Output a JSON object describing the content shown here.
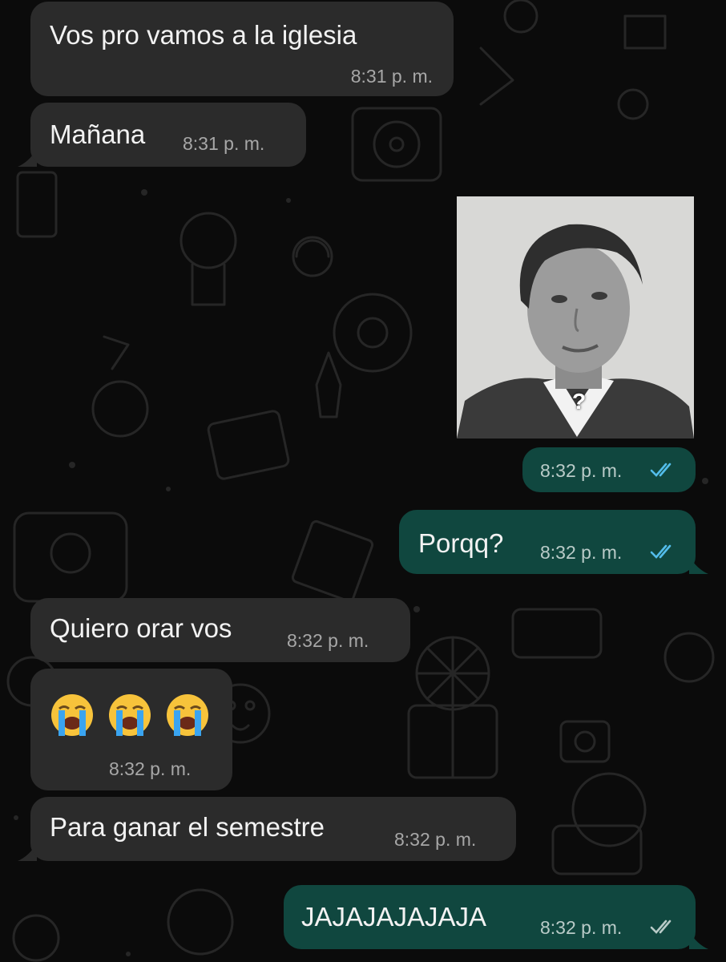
{
  "theme": {
    "incoming_bubble": "#2b2b2b",
    "outgoing_bubble": "#10473f",
    "read_tick_color": "#53bdeb",
    "sent_tick_color": "#b9cbc8"
  },
  "messages": [
    {
      "dir": "in",
      "text": "Vos pro vamos a la iglesia",
      "time": "8:31 p. m."
    },
    {
      "dir": "in",
      "text": "Mañana",
      "time": "8:31 p. m."
    },
    {
      "dir": "out",
      "type": "photo",
      "caption_mark": "?",
      "time": "8:32 p. m.",
      "status": "read"
    },
    {
      "dir": "out",
      "text": "Porqq?",
      "time": "8:32 p. m.",
      "status": "read"
    },
    {
      "dir": "in",
      "text": "Quiero orar vos",
      "time": "8:32 p. m."
    },
    {
      "dir": "in",
      "type": "emoji",
      "emoji": [
        "loudly-crying-face",
        "loudly-crying-face",
        "loudly-crying-face"
      ],
      "time": "8:32 p. m."
    },
    {
      "dir": "in",
      "text": "Para ganar el semestre",
      "time": "8:32 p. m."
    },
    {
      "dir": "out",
      "text": "JAJAJAJAJAJA",
      "time": "8:32 p. m.",
      "status": "delivered"
    }
  ]
}
